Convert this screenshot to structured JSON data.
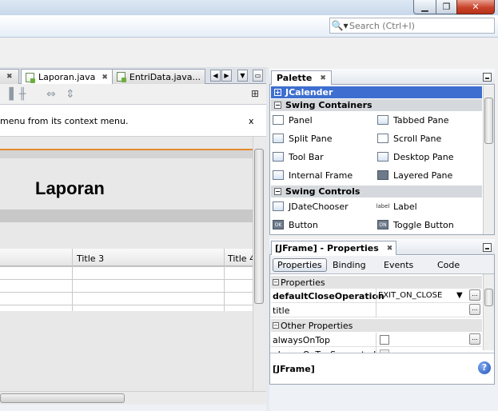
{
  "search": {
    "placeholder": "Search (Ctrl+I)"
  },
  "editor": {
    "tabs": [
      {
        "label": "Laporan.java",
        "active": true
      },
      {
        "label": "EntriData.java..."
      }
    ],
    "hint_text": "menu from its context menu.",
    "hint_close": "x",
    "form": {
      "title": "Laporan",
      "table_headers": [
        "Title 3",
        "Title 4"
      ]
    }
  },
  "palette": {
    "title": "Palette",
    "categories": [
      {
        "label": "JCalender",
        "selected": true
      },
      {
        "label": "Swing Containers"
      },
      {
        "label": "Swing Controls"
      }
    ],
    "containers": [
      "Panel",
      "Tabbed Pane",
      "Split Pane",
      "Scroll Pane",
      "Tool Bar",
      "Desktop Pane",
      "Internal Frame",
      "Layered Pane"
    ],
    "controls": [
      "JDateChooser",
      "Label",
      "Button",
      "Toggle Button"
    ],
    "icon_labels": {
      "label": "label",
      "button": "OK",
      "toggle": "ON"
    }
  },
  "properties": {
    "title": "[JFrame] - Properties",
    "subtabs": [
      "Properties",
      "Binding",
      "Events",
      "Code"
    ],
    "sections": [
      "Properties",
      "Other Properties"
    ],
    "rows": [
      {
        "name": "defaultCloseOperation",
        "value": "EXIT_ON_CLOSE"
      },
      {
        "name": "title",
        "value": ""
      },
      {
        "name": "alwaysOnTop",
        "value": ""
      },
      {
        "name": "alwaysOnTopSupported",
        "value": ""
      }
    ],
    "description": "[JFrame]"
  },
  "colors": {
    "selection": "#3e6fd0",
    "close_button": "#c9432c",
    "orange_accent": "#e48b2c"
  }
}
